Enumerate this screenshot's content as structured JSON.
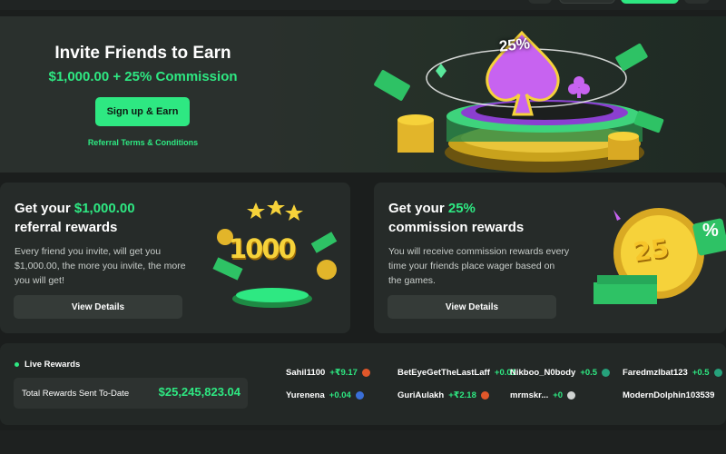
{
  "hero": {
    "title": "Invite Friends to Earn",
    "subtitle": "$1,000.00 + 25% Commission",
    "signup_label": "Sign up & Earn",
    "terms_label": "Referral Terms & Conditions",
    "art_badge": "25%"
  },
  "referral_card": {
    "title_prefix": "Get your ",
    "title_highlight": "$1,000.00",
    "title_suffix": "referral rewards",
    "description": "Every friend you invite, will get you $1,000.00, the more you invite, the more you will get!",
    "details_label": "View Details",
    "art_text": "1000"
  },
  "commission_card": {
    "title_prefix": "Get your ",
    "title_highlight": "25%",
    "title_suffix": "commission rewards",
    "description": "You will receive commission rewards every time your friends place wager based on the games.",
    "details_label": "View Details",
    "art_text": "25",
    "art_pct": "%"
  },
  "live_rewards": {
    "heading": "Live Rewards",
    "total_label": "Total Rewards Sent To-Date",
    "total_value": "$25,245,823.04",
    "feed": [
      {
        "user": "Sahil1100",
        "amount": "+₹9.17",
        "coin_color": "#e0572a"
      },
      {
        "user": "BetEyeGetTheLastLaff",
        "amount": "+0.01",
        "coin_color": "#2ee882"
      },
      {
        "user": "Nikboo_N0body",
        "amount": "+0.5",
        "coin_color": "#26a17b"
      },
      {
        "user": "Faredmzlbat123",
        "amount": "+0.5",
        "coin_color": "#26a17b"
      },
      {
        "user": "Yurenena",
        "amount": "+0.04",
        "coin_color": "#3a6fd8"
      },
      {
        "user": "GuriAulakh",
        "amount": "+₹2.18",
        "coin_color": "#e0572a"
      },
      {
        "user": "mrmskr...",
        "amount": "+0",
        "coin_color": "#cfd3d1"
      },
      {
        "user": "ModernDolphin103539",
        "amount": "",
        "coin_color": ""
      }
    ]
  },
  "colors": {
    "accent": "#2ee882",
    "background": "#1b1e1d",
    "card": "#262b29",
    "gold": "#f6d23a"
  }
}
